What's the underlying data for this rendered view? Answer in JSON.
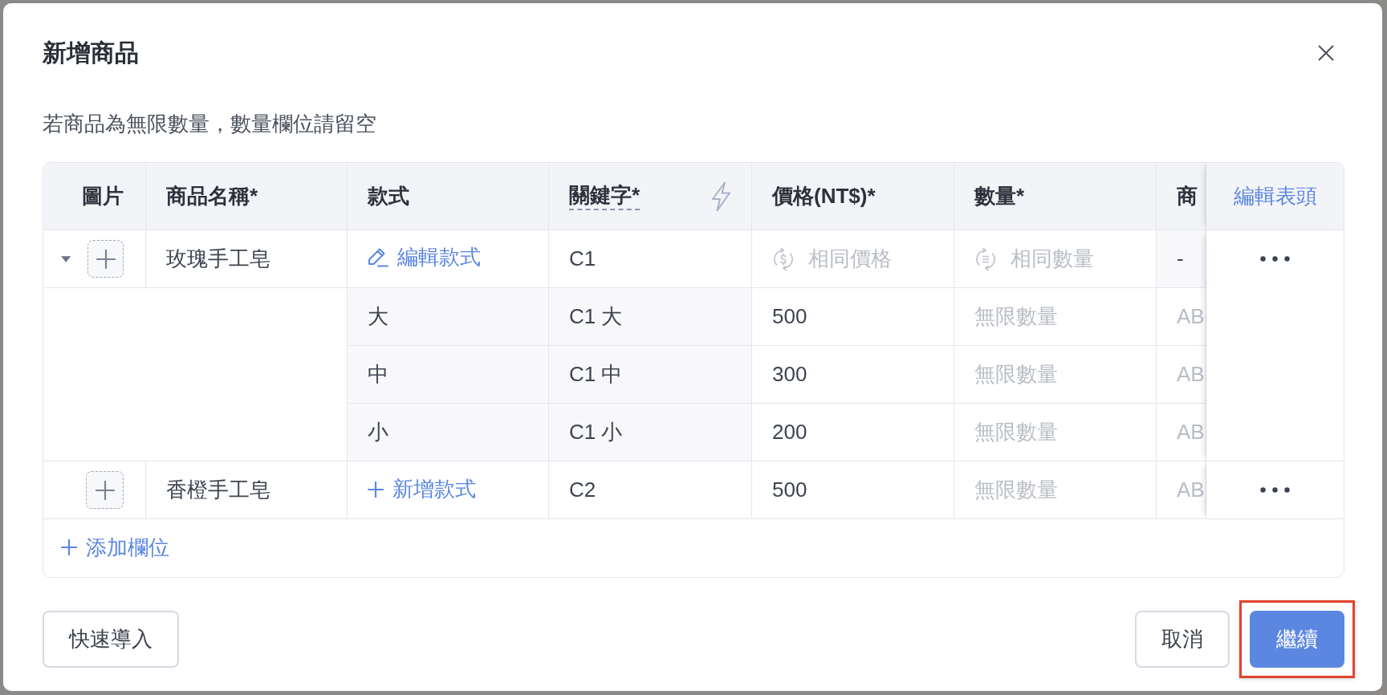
{
  "dialog": {
    "title": "新增商品",
    "note": "若商品為無限數量，數量欄位請留空"
  },
  "table": {
    "columns": [
      {
        "label": "圖片",
        "kind": "plain"
      },
      {
        "label": "商品名稱*",
        "kind": "plain"
      },
      {
        "label": "款式",
        "kind": "plain"
      },
      {
        "label": "關鍵字*",
        "kind": "hinted"
      },
      {
        "label": "價格(NT$)*",
        "kind": "plain"
      },
      {
        "label": "數量*",
        "kind": "plain"
      },
      {
        "label": "商",
        "kind": "plain"
      }
    ],
    "action_header": "編輯表頭",
    "products": [
      {
        "expanded": true,
        "name": {
          "value": "玫瑰手工皂"
        },
        "style_action": {
          "kind": "edit",
          "label": "編輯款式"
        },
        "keyword": {
          "value": "C1"
        },
        "price": {
          "kind": "sync",
          "placeholder": "相同價格"
        },
        "quantity": {
          "kind": "sync",
          "placeholder": "相同數量"
        },
        "column_7": {
          "value": "-"
        },
        "variants": [
          {
            "name": {
              "value": "大"
            },
            "keyword": {
              "value": "C1 大"
            },
            "price": {
              "value": "500"
            },
            "quantity": {
              "placeholder": "無限數量"
            },
            "column_7": {
              "placeholder": "AB"
            }
          },
          {
            "name": {
              "value": "中"
            },
            "keyword": {
              "value": "C1 中"
            },
            "price": {
              "value": "300"
            },
            "quantity": {
              "placeholder": "無限數量"
            },
            "column_7": {
              "placeholder": "AB"
            }
          },
          {
            "name": {
              "value": "小"
            },
            "keyword": {
              "value": "C1 小"
            },
            "price": {
              "value": "200"
            },
            "quantity": {
              "placeholder": "無限數量"
            },
            "column_7": {
              "placeholder": "AB"
            }
          }
        ]
      },
      {
        "name": {
          "value": "香橙手工皂"
        },
        "style_action": {
          "kind": "add",
          "label": "新增款式"
        },
        "keyword": {
          "value": "C2"
        },
        "price": {
          "value": "500"
        },
        "quantity": {
          "placeholder": "無限數量"
        },
        "column_7": {
          "placeholder": "AB"
        }
      }
    ],
    "add_row_link": "添加欄位"
  },
  "footer": {
    "left_buttons": [
      {
        "label": "快速導入",
        "kind": "outline",
        "highlighted": false
      }
    ],
    "right_buttons": [
      {
        "label": "取消",
        "kind": "outline",
        "highlighted": false
      },
      {
        "label": "繼續",
        "kind": "primary",
        "highlighted": true
      }
    ]
  }
}
